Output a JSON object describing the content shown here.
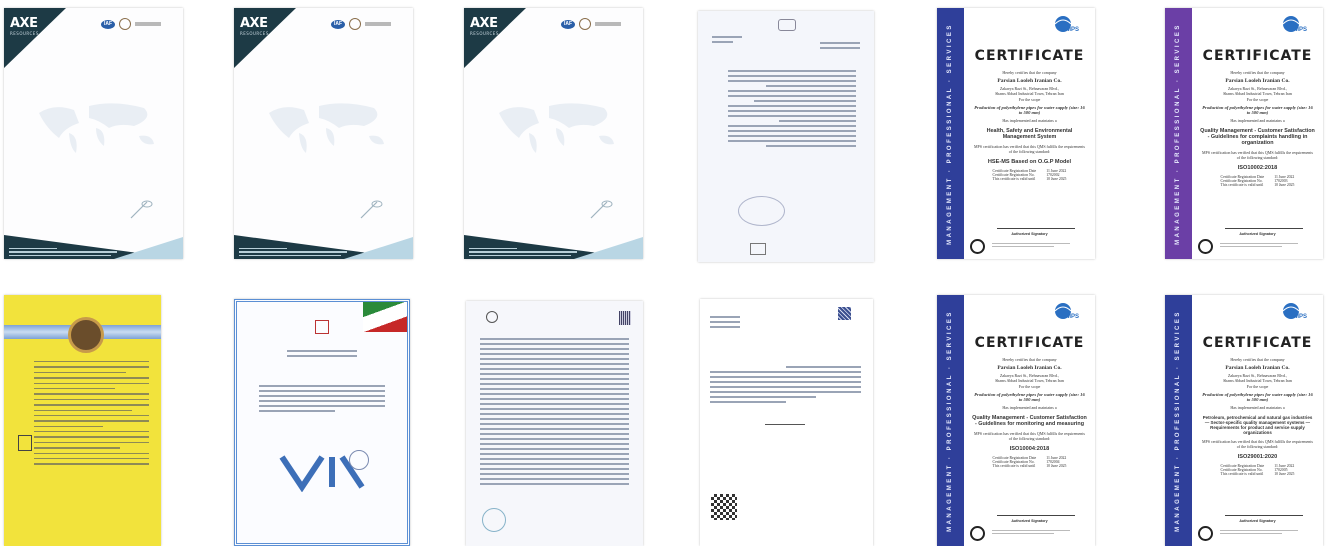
{
  "letterhead": {
    "brand": "AXE",
    "tagline": "RESOURCES",
    "badge": "IAF"
  },
  "certificate": {
    "heading": "CERTIFICATE",
    "band_text": "MANAGEMENT · PROFESSIONAL · SERVICES",
    "hereby": "Hereby certifies that the company",
    "company": "Parsian Looleh Iranian Co.",
    "address1": "Zakaeya Razi St., Behnavaran Blvd.,",
    "address2": "Shams Abbad Industrial Town, Tehran Iran",
    "for_scope": "For the scope",
    "scope": "Production of polyethylene pipes for water supply (size: 16 to 500 mm)",
    "has_impl": "Has implemented and maintains a",
    "mps_text": "MPS certification has verified that this QMS fulfills the requirements of the following standard:",
    "reg_date_label": "Certificate Registration Date",
    "reg_no_label": "Certificate Registration No.",
    "valid_label": "This certificate is valid until",
    "reg_date": "11 June 2022",
    "valid_until": "10 June 2025",
    "signatory": "Authorized Signatory"
  },
  "certs": [
    {
      "band_color": "#2f3f9a",
      "system": "Health, Safety and Environmental Management System",
      "standard": "HSE-MS Based on O.G.P Model",
      "reg_no": "1702002"
    },
    {
      "band_color": "#6b3fa6",
      "system": "Quality Management - Customer Satisfaction - Guidelines for complaints handling in organization",
      "standard": "ISO10002:2018",
      "reg_no": "1702003"
    },
    {
      "band_color": "#2f3f9a",
      "system": "Quality Management - Customer Satisfaction - Guidelines for monitoring and measuring",
      "standard": "ISO10004:2018",
      "reg_no": "1702004"
    },
    {
      "band_color": "#2f3f9a",
      "system": "Petroleum, petrochemical and natural gas industries — Sector-specific quality management systems — Requirements for product and service supply organizations",
      "standard": "ISO29001:2020",
      "reg_no": "1702005"
    }
  ],
  "colors": {
    "letterhead_dark": "#1d3a45",
    "letterhead_light": "#b9d6e4",
    "yellow": "#f2e33c"
  }
}
